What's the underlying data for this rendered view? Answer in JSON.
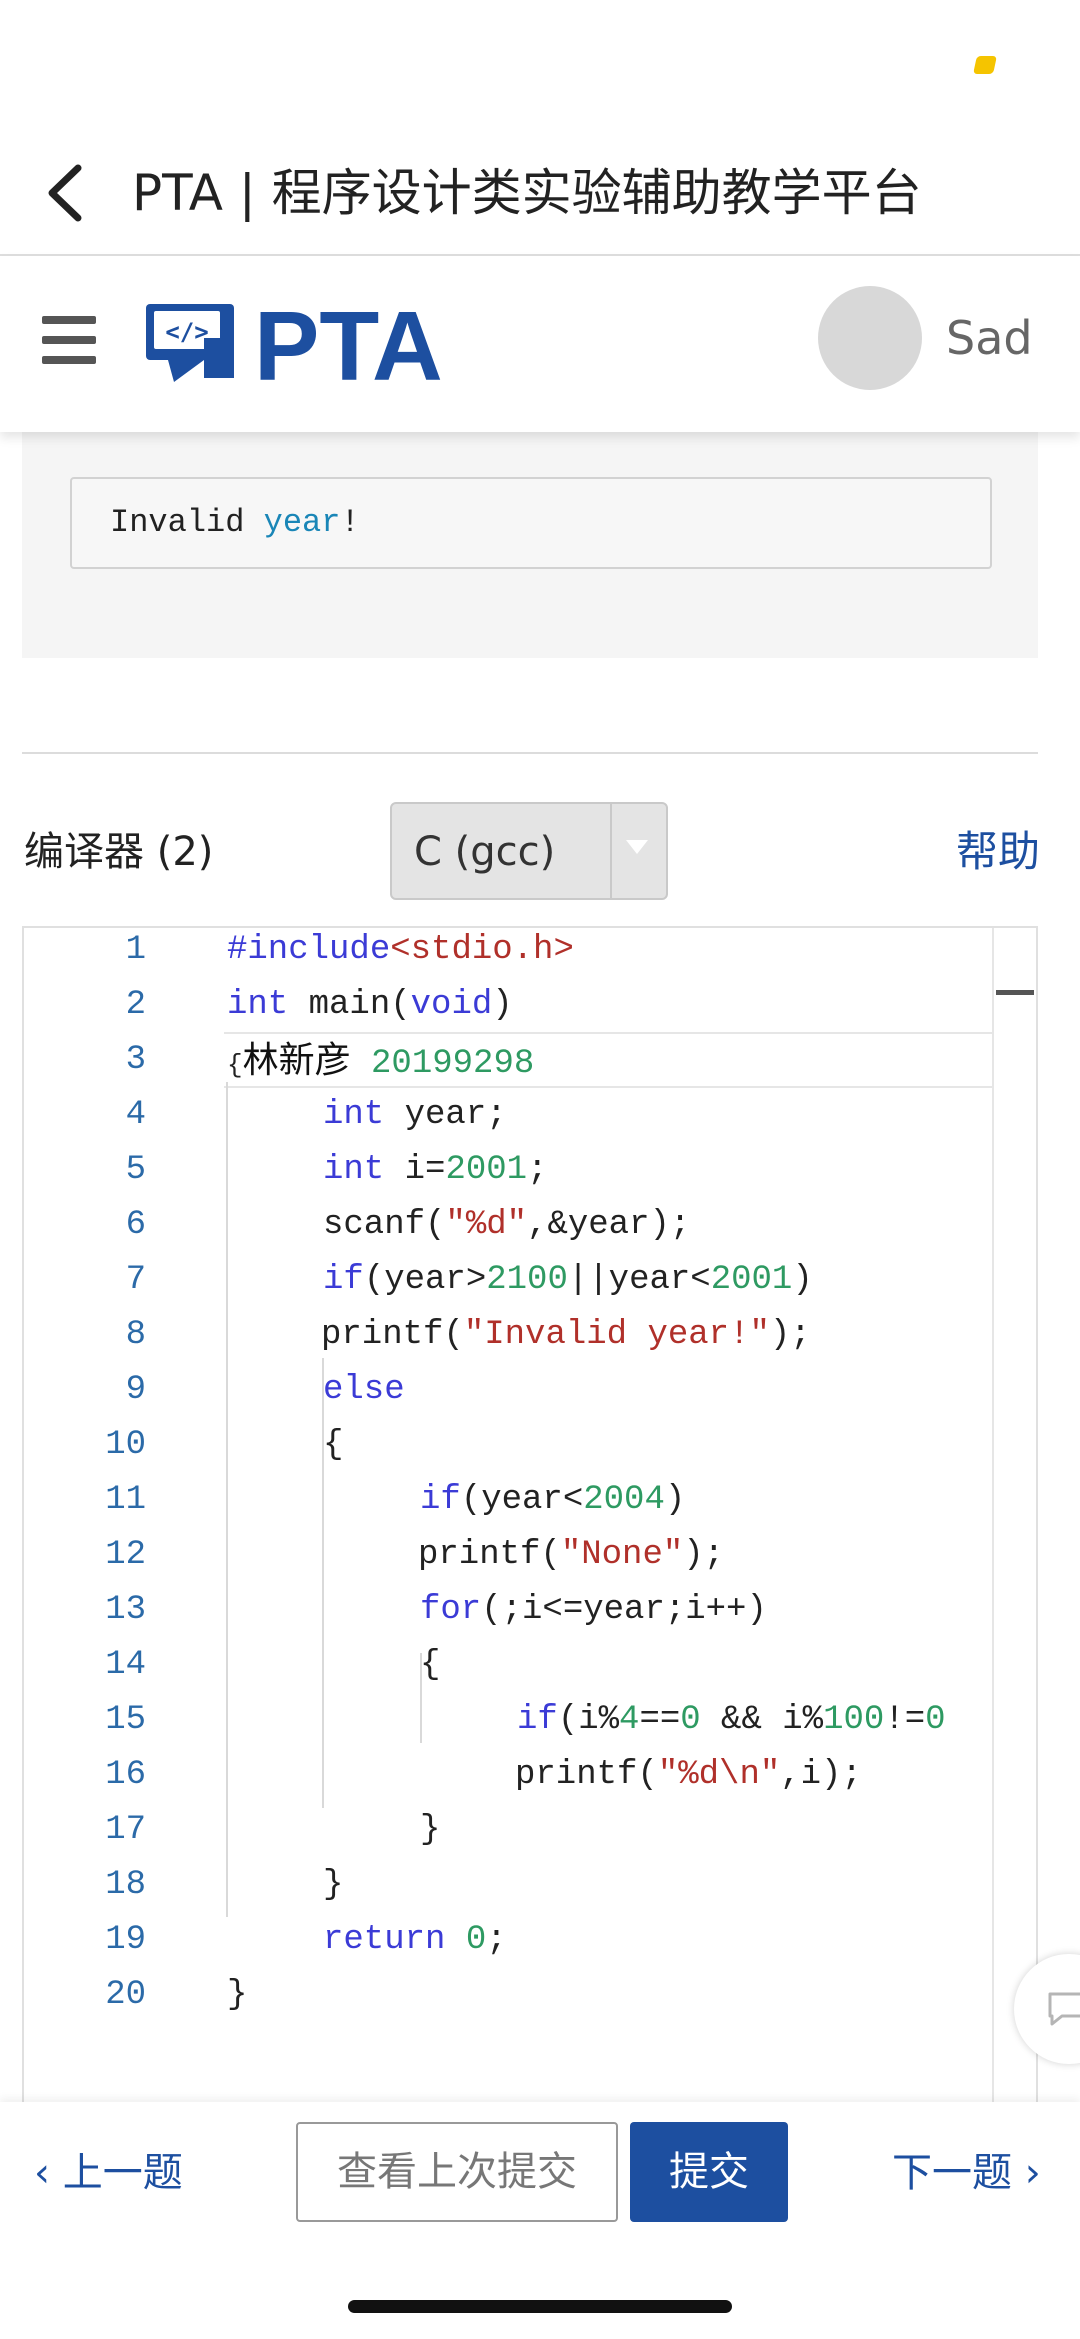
{
  "browser": {
    "title": "PTA | 程序设计类实验辅助教学平台"
  },
  "header": {
    "logo_text": "PTA",
    "username": "Sad"
  },
  "sample": {
    "text_plain": "Invalid ",
    "text_kw": "year",
    "text_end": "!"
  },
  "compiler": {
    "label": "编译器 (2)",
    "value": "C (gcc)",
    "help": "帮助"
  },
  "editor": {
    "lines": [
      {
        "n": "1"
      },
      {
        "n": "2"
      },
      {
        "n": "3"
      },
      {
        "n": "4"
      },
      {
        "n": "5"
      },
      {
        "n": "6"
      },
      {
        "n": "7"
      },
      {
        "n": "8"
      },
      {
        "n": "9"
      },
      {
        "n": "10"
      },
      {
        "n": "11"
      },
      {
        "n": "12"
      },
      {
        "n": "13"
      },
      {
        "n": "14"
      },
      {
        "n": "15"
      },
      {
        "n": "16"
      },
      {
        "n": "17"
      },
      {
        "n": "18"
      },
      {
        "n": "19"
      },
      {
        "n": "20"
      }
    ],
    "code": {
      "l1_kw": "#include",
      "l1_str": "<stdio.h>",
      "l2_kw": "int",
      "l2_a": " main(",
      "l2_def": "void",
      "l2_b": ")",
      "l3_brace": "{",
      "l3_name": "林新彦",
      "l3_num": " 20199298",
      "l4_kw": "int",
      "l4_rest": " year;",
      "l5_kw": "int",
      "l5_a": " i=",
      "l5_num": "2001",
      "l5_b": ";",
      "l6_a": "scanf(",
      "l6_str": "\"%d\"",
      "l6_b": ",&year);",
      "l7_kw": "if",
      "l7_a": "(year>",
      "l7_n1": "2100",
      "l7_b": "||year<",
      "l7_n2": "2001",
      "l7_c": ")",
      "l8_a": "printf(",
      "l8_str": "\"Invalid year!\"",
      "l8_b": ");",
      "l9_kw": "else",
      "l10": "{",
      "l11_kw": "if",
      "l11_a": "(year<",
      "l11_num": "2004",
      "l11_b": ")",
      "l12_a": "printf(",
      "l12_str": "\"None\"",
      "l12_b": ");",
      "l13_kw": "for",
      "l13_rest": "(;i<=year;i++)",
      "l14": "{",
      "l15_kw": "if",
      "l15_a": "(i%",
      "l15_n1": "4",
      "l15_b": "==",
      "l15_n2": "0",
      "l15_c": " && i%",
      "l15_n3": "100",
      "l15_d": "!=",
      "l15_n4": "0",
      "l16_a": "printf(",
      "l16_str": "\"%d\\n\"",
      "l16_b": ",i);",
      "l17": "}",
      "l18": "}",
      "l19_kw": "return",
      "l19_sp": " ",
      "l19_num": "0",
      "l19_b": ";",
      "l20": "}"
    }
  },
  "bottom": {
    "prev": "上一题",
    "last_submission": "查看上次提交",
    "submit": "提交",
    "next": "下一题"
  },
  "colors": {
    "brand_blue": "#1d4fa0",
    "keyword": "#3b3bd6",
    "string": "#b0302a",
    "number": "#2e9a62"
  }
}
